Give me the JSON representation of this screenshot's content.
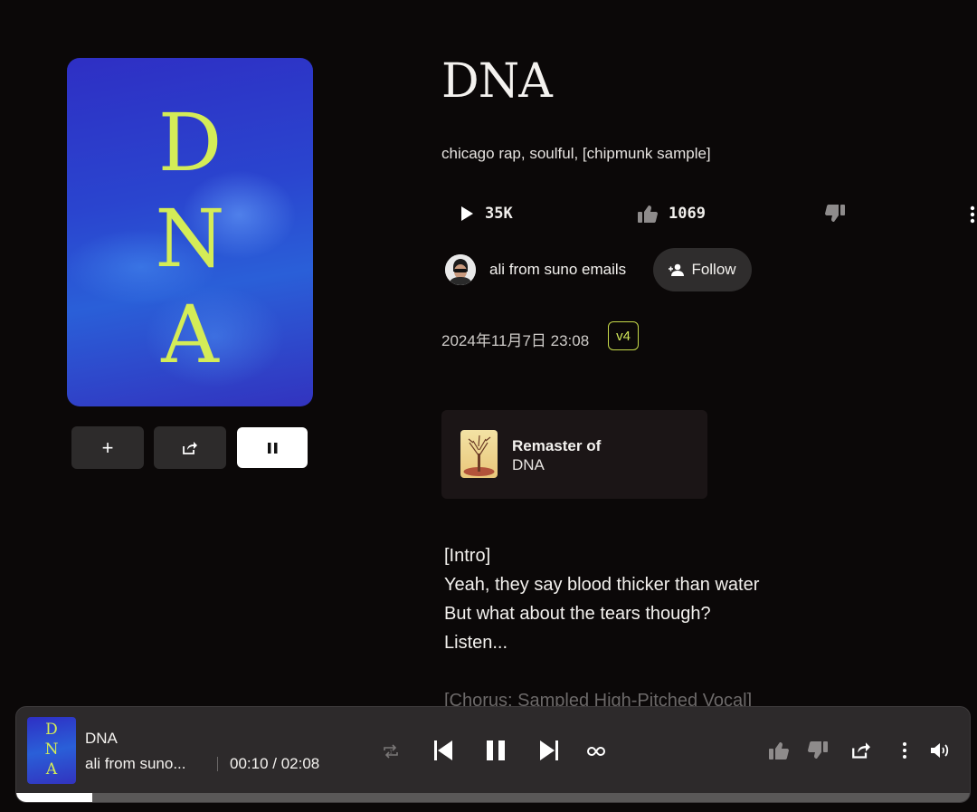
{
  "song": {
    "title": "DNA",
    "cover_letters": [
      "D",
      "N",
      "A"
    ],
    "tags": "chicago rap, soulful, [chipmunk sample]",
    "plays": "35K",
    "likes": "1069",
    "date": "2024年11月7日 23:08",
    "version": "v4"
  },
  "author": {
    "name": "ali from suno emails",
    "follow_label": "Follow"
  },
  "cover_actions": {
    "add_label": "+"
  },
  "remaster": {
    "heading": "Remaster of",
    "title": "DNA"
  },
  "lyrics": [
    "[Intro]",
    "Yeah, they say blood thicker than water",
    "But what about the tears though?",
    "Listen..."
  ],
  "lyrics_cut": "[Chorus: Sampled High-Pitched Vocal]",
  "player": {
    "title": "DNA",
    "artist": "ali from suno...",
    "time": "00:10 / 02:08",
    "progress": 0.08
  },
  "colors": {
    "accent": "#d4ec57",
    "background": "#0b0808",
    "player_bg": "#2d2a2b"
  },
  "icons": {
    "play": "play-icon",
    "like": "thumbs-up-icon",
    "dislike": "thumbs-down-icon",
    "more": "more-vertical-icon",
    "share": "share-icon",
    "pause": "pause-icon",
    "follow": "user-plus-icon",
    "repeat": "repeat-icon",
    "previous": "skip-back-icon",
    "next": "skip-forward-icon",
    "loop": "infinity-icon",
    "volume": "volume-icon"
  }
}
